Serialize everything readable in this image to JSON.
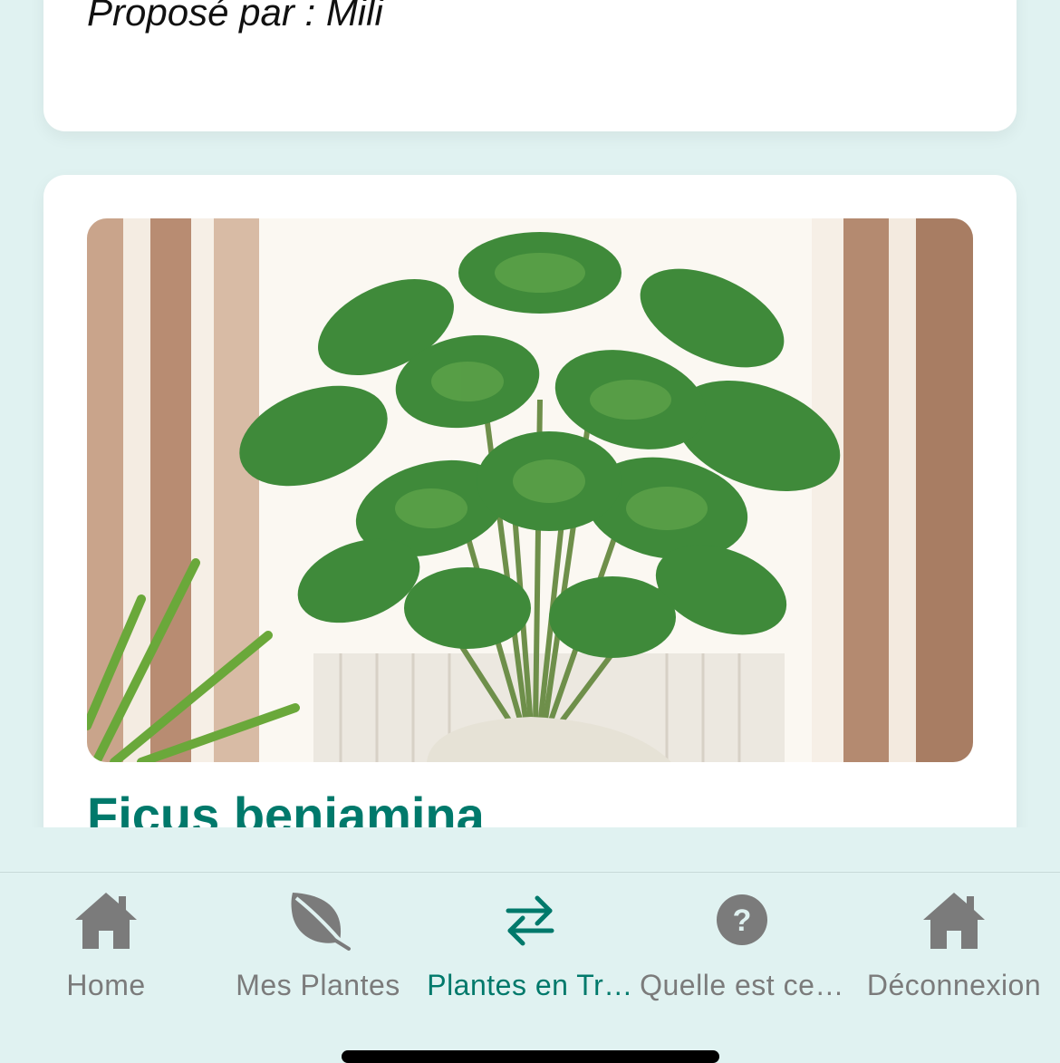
{
  "previous_card": {
    "author_line": "Proposé par : Mili"
  },
  "plant_card": {
    "image_alt": "plante verte en pot",
    "name": "Ficus benjamina"
  },
  "tabbar": {
    "active_color": "#00796b",
    "inactive_color": "#7b7b7b",
    "items": [
      {
        "label": "Home",
        "icon": "home-icon"
      },
      {
        "label": "Mes Plantes",
        "icon": "leaf-icon"
      },
      {
        "label": "Plantes en Tr…",
        "icon": "swap-arrows-icon",
        "active": true
      },
      {
        "label": "Quelle est ce…",
        "icon": "question-circle-icon"
      },
      {
        "label": "Déconnexion",
        "icon": "home-icon"
      }
    ]
  }
}
